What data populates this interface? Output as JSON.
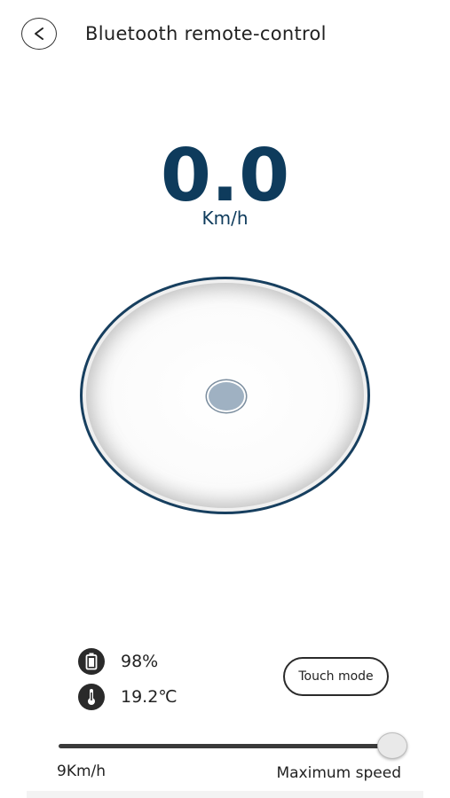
{
  "header": {
    "title": "Bluetooth remote-control",
    "back_icon": "chevron-left-icon"
  },
  "speedometer": {
    "value": "0.0",
    "unit": "Km/h"
  },
  "joystick": {
    "knob_offset_x": 0,
    "knob_offset_y": 0
  },
  "status": {
    "battery": "98%",
    "battery_icon": "battery-icon",
    "temperature": "19.2℃",
    "temperature_icon": "thermometer-icon"
  },
  "mode_button": {
    "label": "Touch mode"
  },
  "speed_limit": {
    "min_label": "9Km/h",
    "max_label": "Maximum speed",
    "value_fraction": 1.0
  },
  "colors": {
    "accent": "#0e3b5c",
    "joystick_border": "#173f5f",
    "knob": "#9fb1c2"
  }
}
